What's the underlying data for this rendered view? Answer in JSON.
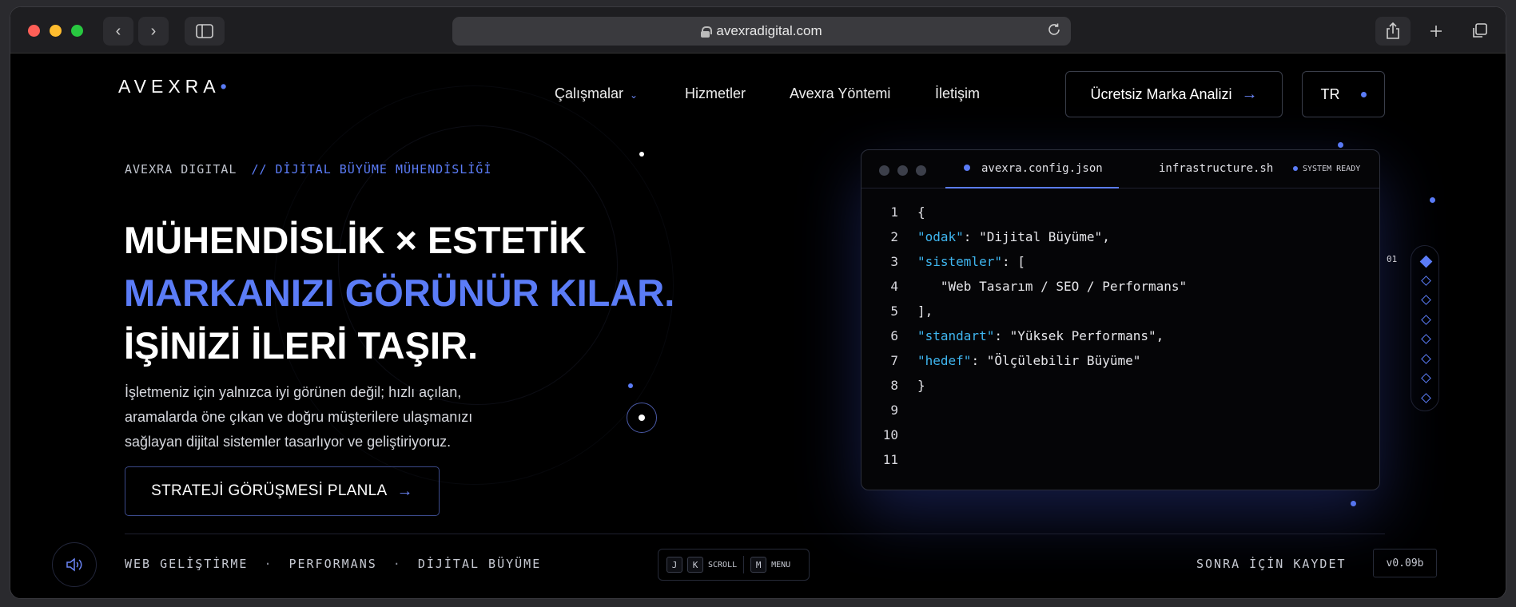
{
  "browser": {
    "url": "avexradigital.com",
    "back_icon": "‹",
    "forward_icon": "›"
  },
  "header": {
    "logo": "AVEXRA",
    "logo_dot": "•",
    "nav": [
      {
        "label": "Çalışmalar"
      },
      {
        "label": "Hizmetler"
      },
      {
        "label": "Avexra Yöntemi"
      },
      {
        "label": "İletişim"
      }
    ],
    "nav_chevron": "⌄",
    "cta_label": "Ücretsiz Marka Analizi",
    "arrow": "→",
    "lang_label": "TR"
  },
  "hero": {
    "eyebrow": "AVEXRA DIGITAL",
    "eyebrow_accent": "// DİJİTAL BÜYÜME MÜHENDİSLİĞİ",
    "line1": "MÜHENDİSLİK × ESTETİK",
    "line2": "MARKANIZI GÖRÜNÜR KILAR.",
    "line3": "İŞİNİZİ İLERİ TAŞIR.",
    "lede": "İşletmeniz için yalnızca iyi görünen değil; hızlı açılan, aramalarda öne çıkan ve doğru müşterilere ulaşmanızı sağlayan dijital sistemler tasarlıyor ve geliştiriyoruz.",
    "cta_label": "STRATEJİ GÖRÜŞMESİ PLANLA"
  },
  "code_window": {
    "tab1": "avexra.config.json",
    "tab2": "infrastructure.sh",
    "status": "SYSTEM READY",
    "lines": [
      {
        "n": "1",
        "pre": "{",
        "key": "",
        "post": ""
      },
      {
        "n": "2",
        "pre": "",
        "key": "\"odak\"",
        "post": ": \"Dijital Büyüme\","
      },
      {
        "n": "3",
        "pre": "",
        "key": "\"sistemler\"",
        "post": ": ["
      },
      {
        "n": "4",
        "pre": "   \"Web Tasarım / SEO / Performans\"",
        "key": "",
        "post": ""
      },
      {
        "n": "5",
        "pre": "],",
        "key": "",
        "post": ""
      },
      {
        "n": "6",
        "pre": "",
        "key": "\"standart\"",
        "post": ": \"Yüksek Performans\","
      },
      {
        "n": "7",
        "pre": "",
        "key": "\"hedef\"",
        "post": ": \"Ölçülebilir Büyüme\""
      },
      {
        "n": "8",
        "pre": "}",
        "key": "",
        "post": ""
      },
      {
        "n": "9",
        "pre": "",
        "key": "",
        "post": ""
      },
      {
        "n": "10",
        "pre": "",
        "key": "",
        "post": ""
      },
      {
        "n": "11",
        "pre": "",
        "key": "",
        "post": ""
      }
    ]
  },
  "rail": {
    "active_number": "01",
    "item_count": 8
  },
  "footer": {
    "tags": [
      "WEB GELİŞTİRME",
      "PERFORMANS",
      "DİJİTAL BÜYÜME"
    ],
    "tag_separator": "·",
    "keys": [
      {
        "key": "J",
        "label": ""
      },
      {
        "key": "K",
        "label": "SCROLL"
      },
      {
        "key": "M",
        "label": "MENU"
      }
    ],
    "save_label": "SONRA İÇİN KAYDET",
    "version": "v0.09b"
  },
  "colors": {
    "accent": "#5b7cf7",
    "code_key": "#3fb6f0",
    "background": "#000000"
  }
}
